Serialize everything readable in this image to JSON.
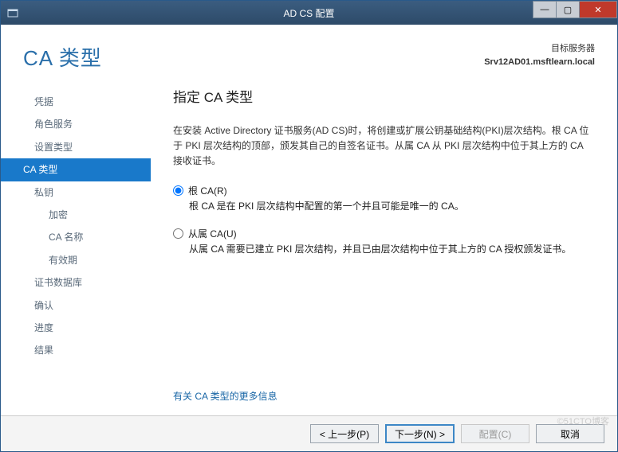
{
  "window": {
    "title": "AD CS 配置"
  },
  "header": {
    "heading": "CA 类型",
    "target_label": "目标服务器",
    "target_server": "Srv12AD01.msftlearn.local"
  },
  "sidebar": {
    "items": [
      {
        "label": "凭据",
        "sub": false,
        "active": false
      },
      {
        "label": "角色服务",
        "sub": false,
        "active": false
      },
      {
        "label": "设置类型",
        "sub": false,
        "active": false
      },
      {
        "label": "CA 类型",
        "sub": false,
        "active": true
      },
      {
        "label": "私钥",
        "sub": false,
        "active": false
      },
      {
        "label": "加密",
        "sub": true,
        "active": false
      },
      {
        "label": "CA 名称",
        "sub": true,
        "active": false
      },
      {
        "label": "有效期",
        "sub": true,
        "active": false
      },
      {
        "label": "证书数据库",
        "sub": false,
        "active": false
      },
      {
        "label": "确认",
        "sub": false,
        "active": false
      },
      {
        "label": "进度",
        "sub": false,
        "active": false
      },
      {
        "label": "结果",
        "sub": false,
        "active": false
      }
    ]
  },
  "main": {
    "title": "指定 CA 类型",
    "intro": "在安装 Active Directory 证书服务(AD CS)时，将创建或扩展公钥基础结构(PKI)层次结构。根 CA 位于 PKI 层次结构的顶部，颁发其自己的自签名证书。从属 CA 从 PKI 层次结构中位于其上方的 CA 接收证书。",
    "options": [
      {
        "label": "根 CA(R)",
        "desc": "根 CA 是在 PKI 层次结构中配置的第一个并且可能是唯一的 CA。",
        "selected": true
      },
      {
        "label": "从属 CA(U)",
        "desc": "从属 CA 需要已建立 PKI 层次结构，并且已由层次结构中位于其上方的 CA 授权颁发证书。",
        "selected": false
      }
    ],
    "more_link": "有关 CA 类型的更多信息"
  },
  "buttons": {
    "prev": "< 上一步(P)",
    "next": "下一步(N) >",
    "configure": "配置(C)",
    "cancel": "取消"
  },
  "watermark": "©51CTO博客"
}
